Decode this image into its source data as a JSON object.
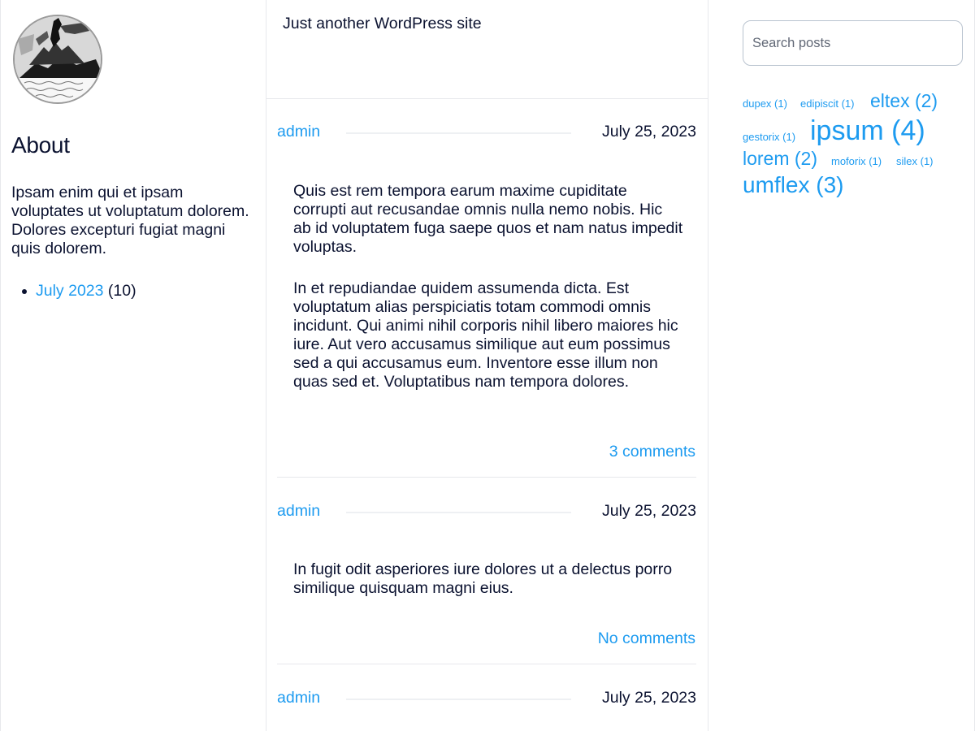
{
  "site": {
    "tagline": "Just another WordPress site"
  },
  "left_sidebar": {
    "about_heading": "About",
    "about_text": "Ipsam enim qui et ipsam voluptates ut voluptatum dolorem. Dolores excepturi fugiat magni quis dolorem.",
    "archives": [
      {
        "label": "July 2023",
        "count": "(10)"
      }
    ]
  },
  "posts": [
    {
      "author": "admin",
      "date": "July 25, 2023",
      "paragraphs": [
        "Quis est rem tempora earum maxime cupiditate corrupti aut recusandae omnis nulla nemo nobis. Hic ab id voluptatem fuga saepe quos et nam natus impedit voluptas.",
        "In et repudiandae quidem assumenda dicta. Est voluptatum alias perspiciatis totam commodi omnis incidunt. Qui animi nihil corporis nihil libero maiores hic iure. Aut vero accusamus similique aut eum possimus sed a qui accusamus eum. Inventore esse illum non quas sed et. Voluptatibus nam tempora dolores."
      ],
      "comments": "3 comments"
    },
    {
      "author": "admin",
      "date": "July 25, 2023",
      "paragraphs": [
        "In fugit odit asperiores iure dolores ut a delectus porro similique quisquam magni eius."
      ],
      "comments": "No comments"
    },
    {
      "author": "admin",
      "date": "July 25, 2023"
    }
  ],
  "right_sidebar": {
    "search_placeholder": "Search posts",
    "tags": [
      {
        "label": "dupex (1)"
      },
      {
        "label": "edipiscit (1)"
      },
      {
        "label": "eltex (2)"
      },
      {
        "label": "gestorix (1)"
      },
      {
        "label": "ipsum (4)"
      },
      {
        "label": "lorem (2)"
      },
      {
        "label": "moforix (1)"
      },
      {
        "label": "silex (1)"
      },
      {
        "label": "umflex (3)"
      }
    ]
  },
  "colors": {
    "link": "#1d9bf0",
    "text": "#0b1230",
    "divider": "#e7e8ec"
  }
}
